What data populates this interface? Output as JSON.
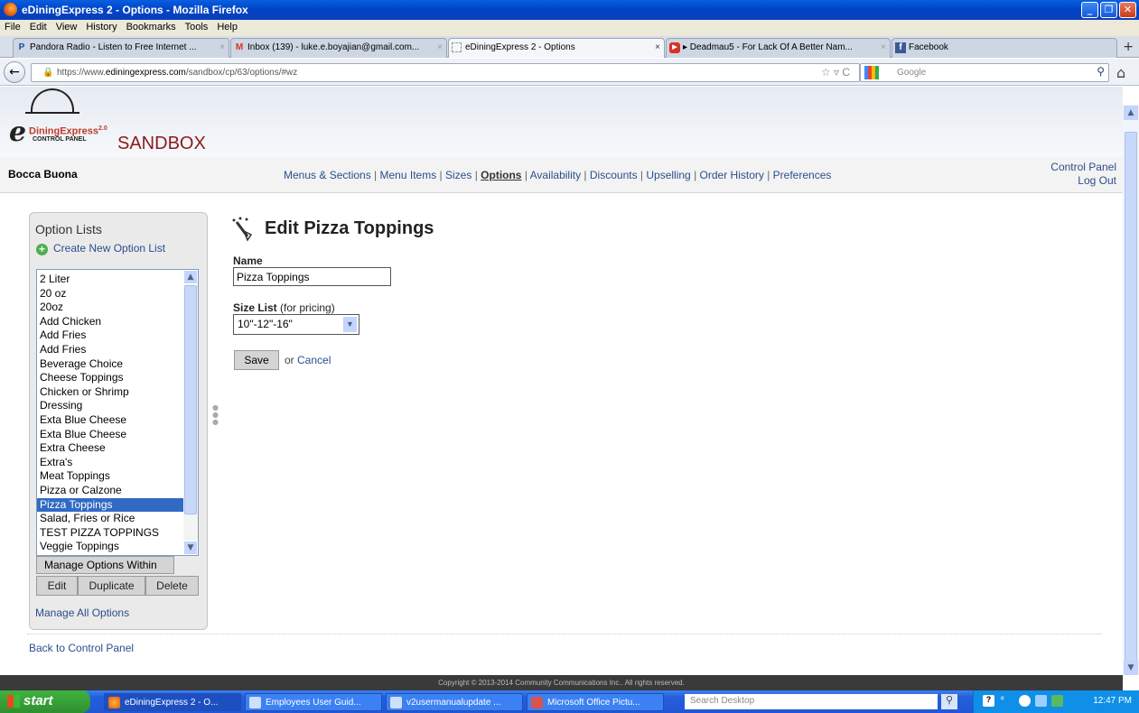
{
  "window": {
    "title": "eDiningExpress 2 - Options - Mozilla Firefox",
    "minimize": "_",
    "restore": "❐",
    "close": "✕"
  },
  "menubar": [
    "File",
    "Edit",
    "View",
    "History",
    "Bookmarks",
    "Tools",
    "Help"
  ],
  "tabs": [
    {
      "label": "Pandora Radio - Listen to Free Internet ...",
      "icon": "P",
      "close": "×"
    },
    {
      "label": "Inbox (139) - luke.e.boyajian@gmail.com...",
      "icon": "M",
      "close": "×"
    },
    {
      "label": "eDiningExpress 2 - Options",
      "icon": "",
      "close": "×"
    },
    {
      "label": "▸ Deadmau5 - For Lack Of A Better Nam...",
      "icon": "▶",
      "close": "×"
    },
    {
      "label": "Facebook",
      "icon": "f",
      "close": ""
    }
  ],
  "new_tab": "+",
  "nav": {
    "url_prefix": "https://www.",
    "url_domain": "ediningexpress.com",
    "url_path": "/sandbox/cp/63/options/#wz",
    "search_placeholder": "Google",
    "star": "☆ ▿ C"
  },
  "header": {
    "brand": "DiningExpress",
    "brand_suffix": "2.0",
    "control_panel": "CONTROL PANEL",
    "sandbox": "SANDBOX"
  },
  "topnav": {
    "restaurant": "Bocca Buona",
    "links": [
      "Menus & Sections",
      "Menu Items",
      "Sizes",
      "Options",
      "Availability",
      "Discounts",
      "Upselling",
      "Order History",
      "Preferences"
    ],
    "selected": "Options",
    "control_panel": "Control Panel",
    "logout": "Log Out"
  },
  "sidebar": {
    "title": "Option Lists",
    "create_new": "Create New Option List",
    "items": [
      "2 Liter",
      "20 oz",
      "20oz",
      "Add Chicken",
      "Add Fries",
      "Add Fries",
      "Beverage Choice",
      "Cheese Toppings",
      "Chicken or Shrimp",
      "Dressing",
      "Exta Blue Cheese",
      "Exta Blue Cheese",
      "Extra Cheese",
      "Extra's",
      "Meat Toppings",
      "Pizza or Calzone",
      "Pizza Toppings",
      "Salad, Fries or Rice",
      "TEST PIZZA TOPPINGS",
      "Veggie Toppings"
    ],
    "selected_index": 16,
    "manage_within": "Manage Options Within",
    "edit": "Edit",
    "duplicate": "Duplicate",
    "delete": "Delete",
    "manage_all": "Manage All Options"
  },
  "form": {
    "title": "Edit Pizza Toppings",
    "name_label": "Name",
    "name_value": "Pizza Toppings",
    "size_label": "Size List",
    "size_label_note": "(for pricing)",
    "size_value": "10\"-12\"-16\"",
    "save": "Save",
    "or": "or",
    "cancel": "Cancel"
  },
  "back_link": "Back to Control Panel",
  "footer": "Copyright © 2013-2014 Community Communications Inc.. All rights reserved.",
  "taskbar": {
    "start": "start",
    "tasks": [
      "eDiningExpress 2 - O...",
      "Employees User Guid...",
      "v2usermanualupdate ...",
      "Microsoft Office Pictu..."
    ],
    "search_placeholder": "Search Desktop",
    "clock": "12:47 PM"
  }
}
